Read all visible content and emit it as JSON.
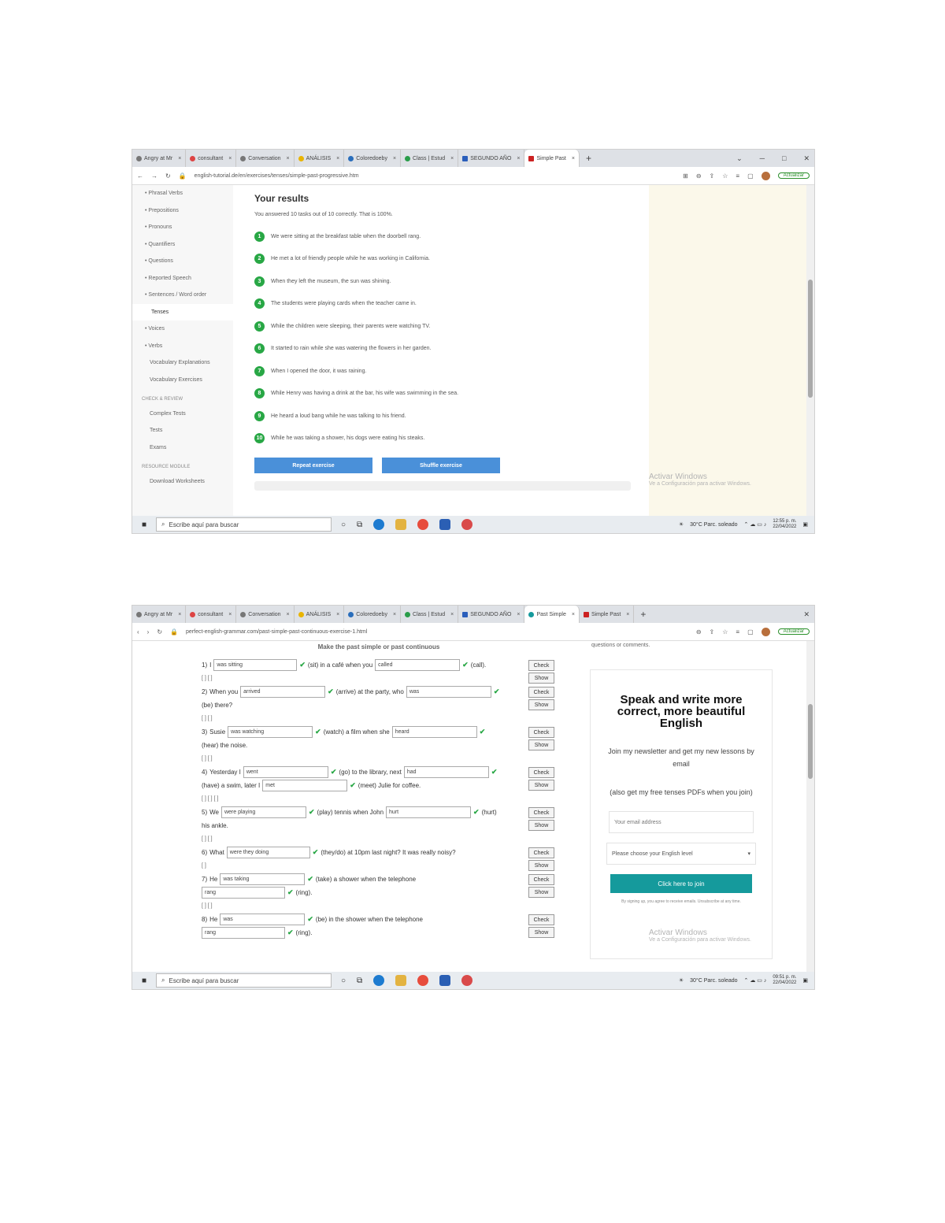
{
  "shot1": {
    "tabs": [
      {
        "label": "Angry at Mr"
      },
      {
        "label": "consultant"
      },
      {
        "label": "Conversation"
      },
      {
        "label": "ANÁLISIS"
      },
      {
        "label": "Coloredoeby"
      },
      {
        "label": "Class | Estud"
      },
      {
        "label": "SEGUNDO AÑO"
      },
      {
        "label": "Simple Past"
      }
    ],
    "url": "english-tutorial.de/en/exercises/tenses/simple-past-progressive.htm",
    "update_label": "Actualizar",
    "sidebar": [
      {
        "label": "• Phrasal Verbs",
        "style": "item"
      },
      {
        "label": "• Prepositions",
        "style": "item"
      },
      {
        "label": "• Pronouns",
        "style": "item"
      },
      {
        "label": "• Quantifiers",
        "style": "item"
      },
      {
        "label": "• Questions",
        "style": "item"
      },
      {
        "label": "• Reported Speech",
        "style": "item"
      },
      {
        "label": "• Sentences / Word order",
        "style": "item"
      },
      {
        "label": "Tenses",
        "style": "active"
      },
      {
        "label": "• Voices",
        "style": "item"
      },
      {
        "label": "• Verbs",
        "style": "item"
      },
      {
        "label": "Vocabulary Explanations",
        "style": "sub"
      },
      {
        "label": "Vocabulary Exercises",
        "style": "sub"
      },
      {
        "label": "CHECK & REVIEW",
        "style": "heading"
      },
      {
        "label": "Complex Tests",
        "style": "sub"
      },
      {
        "label": "Tests",
        "style": "sub"
      },
      {
        "label": "Exams",
        "style": "sub"
      },
      {
        "label": "RESOURCE MODULE",
        "style": "heading"
      },
      {
        "label": "Download Worksheets",
        "style": "sub"
      }
    ],
    "results_title": "Your results",
    "results_summary": "You answered 10 tasks out of 10 correctly. That is 100%.",
    "results": [
      {
        "n": "1",
        "text": "We were sitting at the breakfast table when the doorbell rang."
      },
      {
        "n": "2",
        "text": "He met a lot of friendly people while he was working in California."
      },
      {
        "n": "3",
        "text": "When they left the museum, the sun was shining."
      },
      {
        "n": "4",
        "text": "The students were playing cards when the teacher came in."
      },
      {
        "n": "5",
        "text": "While the children were sleeping, their parents were watching TV."
      },
      {
        "n": "6",
        "text": "It started to rain while she was watering the flowers in her garden."
      },
      {
        "n": "7",
        "text": "When I opened the door, it was raining."
      },
      {
        "n": "8",
        "text": "While Henry was having a drink at the bar, his wife was swimming in the sea."
      },
      {
        "n": "9",
        "text": "He heard a loud bang while he was talking to his friend."
      },
      {
        "n": "10",
        "text": "While he was taking a shower, his dogs were eating his steaks."
      }
    ],
    "repeat_label": "Repeat exercise",
    "shuffle_label": "Shuffle exercise",
    "watermark_title": "Activar Windows",
    "watermark_sub": "Ve a Configuración para activar Windows.",
    "taskbar": {
      "search": "Escribe aquí para buscar",
      "weather": "30°C Parc. soleado",
      "time": "12:55 p. m.",
      "date": "22/04/2022"
    }
  },
  "shot2": {
    "tabs": [
      {
        "label": "Angry at Mr"
      },
      {
        "label": "consultant"
      },
      {
        "label": "Conversation"
      },
      {
        "label": "ANÁLISIS"
      },
      {
        "label": "Coloredoeby"
      },
      {
        "label": "Class | Estud"
      },
      {
        "label": "SEGUNDO AÑO"
      },
      {
        "label": "Past Simple"
      },
      {
        "label": "Simple Past"
      }
    ],
    "url": "perfect-english-grammar.com/past-simple-past-continuous-exercise-1.html",
    "update_label": "Actualizar",
    "exercise_title": "Make the past simple or past continuous",
    "check_label": "Check",
    "show_label": "Show",
    "questions": [
      {
        "num": "1)",
        "lines": [
          [
            {
              "t": "I"
            },
            {
              "i": "was sitting",
              "w": 98
            },
            {
              "t": "(sit) in a café when you"
            },
            {
              "i": "called",
              "w": 100
            },
            {
              "t": "(call)."
            }
          ],
          [
            {
              "b": "[ ] [ ]"
            }
          ]
        ]
      },
      {
        "num": "2)",
        "lines": [
          [
            {
              "t": "When you"
            },
            {
              "i": "arrived",
              "w": 100
            },
            {
              "t": "(arrive) at the party, who"
            },
            {
              "i": "was",
              "w": 100
            }
          ],
          [
            {
              "t": "(be) there?"
            }
          ],
          [
            {
              "b": "[ ] [ ]"
            }
          ]
        ]
      },
      {
        "num": "3)",
        "lines": [
          [
            {
              "t": "Susie"
            },
            {
              "i": "was watching",
              "w": 100
            },
            {
              "t": "(watch) a film when she"
            },
            {
              "i": "heard",
              "w": 100
            }
          ],
          [
            {
              "t": "(hear) the noise."
            }
          ],
          [
            {
              "b": "[ ] [ ]"
            }
          ]
        ]
      },
      {
        "num": "4)",
        "lines": [
          [
            {
              "t": "Yesterday I"
            },
            {
              "i": "went",
              "w": 100
            },
            {
              "t": "(go) to the library, next"
            },
            {
              "i": "had",
              "w": 100
            }
          ],
          [
            {
              "t": "(have) a swim, later I"
            },
            {
              "i": "met",
              "w": 100
            },
            {
              "t": "(meet) Julie for coffee."
            }
          ],
          [
            {
              "b": "[ ] [ ] [ ]"
            }
          ]
        ]
      },
      {
        "num": "5)",
        "lines": [
          [
            {
              "t": "We"
            },
            {
              "i": "were playing",
              "w": 100
            },
            {
              "t": "(play) tennis when John"
            },
            {
              "i": "hurt",
              "w": 100
            },
            {
              "t": "(hurt)"
            }
          ],
          [
            {
              "t": "his ankle."
            }
          ],
          [
            {
              "b": "[ ] [ ]"
            }
          ]
        ]
      },
      {
        "num": "6)",
        "lines": [
          [
            {
              "t": "What"
            },
            {
              "i": "were they doing",
              "w": 98
            },
            {
              "t": "(they/do) at 10pm last night? It was really noisy?"
            }
          ],
          [
            {
              "b": "[ ]"
            }
          ]
        ]
      },
      {
        "num": "7)",
        "lines": [
          [
            {
              "t": "He"
            },
            {
              "i": "was taking",
              "w": 100
            },
            {
              "t": "(take) a shower when the telephone"
            }
          ],
          [
            {
              "i": "rang",
              "w": 98
            },
            {
              "t": "(ring)."
            }
          ],
          [
            {
              "b": "[ ] [ ]"
            }
          ]
        ]
      },
      {
        "num": "8)",
        "lines": [
          [
            {
              "t": "He"
            },
            {
              "i": "was",
              "w": 100
            },
            {
              "t": "(be) in the shower when the telephone"
            }
          ],
          [
            {
              "i": "rang",
              "w": 98
            },
            {
              "t": "(ring)."
            }
          ]
        ]
      }
    ],
    "side_top_text": "questions or comments.",
    "newsletter": {
      "heading": "Speak and write more correct, more beautiful English",
      "para1": "Join my newsletter and get my new lessons by email",
      "para2": "(also get my free tenses PDFs when you join)",
      "email_placeholder": "Your email address",
      "level_select": "Please choose your English level",
      "button": "Click here to join",
      "fine_print": "By signing up, you agree to receive emails. Unsubscribe at any time."
    },
    "watermark_title": "Activar Windows",
    "watermark_sub": "Ve a Configuración para activar Windows.",
    "taskbar": {
      "search": "Escribe aquí para buscar",
      "weather": "30°C Parc. soleado",
      "time": "09:51 p. m.",
      "date": "22/04/2022"
    }
  }
}
